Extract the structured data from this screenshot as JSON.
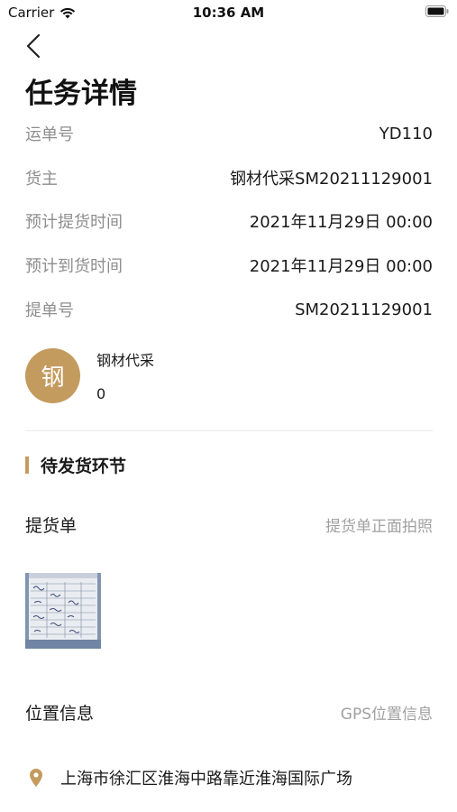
{
  "status_bar": {
    "carrier": "Carrier",
    "time": "10:36 AM"
  },
  "header": {
    "title": "任务详情"
  },
  "info_rows": [
    {
      "label": "运单号",
      "value": "YD110"
    },
    {
      "label": "货主",
      "value": "钢材代采SM20211129001"
    },
    {
      "label": "预计提货时间",
      "value": "2021年11月29日 00:00"
    },
    {
      "label": "预计到货时间",
      "value": "2021年11月29日 00:00"
    },
    {
      "label": "提单号",
      "value": "SM20211129001"
    }
  ],
  "owner": {
    "avatar_text": "钢",
    "name": "钢材代采",
    "count": "0"
  },
  "section": {
    "title": "待发货环节"
  },
  "pickup": {
    "label": "提货单",
    "hint": "提货单正面拍照"
  },
  "location_info": {
    "label": "位置信息",
    "hint": "GPS位置信息",
    "address": "上海市徐汇区淮海中路靠近淮海国际广场"
  },
  "colors": {
    "accent": "#c49b5e",
    "label_gray": "#8e8e8e",
    "hint_gray": "#a0a0a0"
  }
}
